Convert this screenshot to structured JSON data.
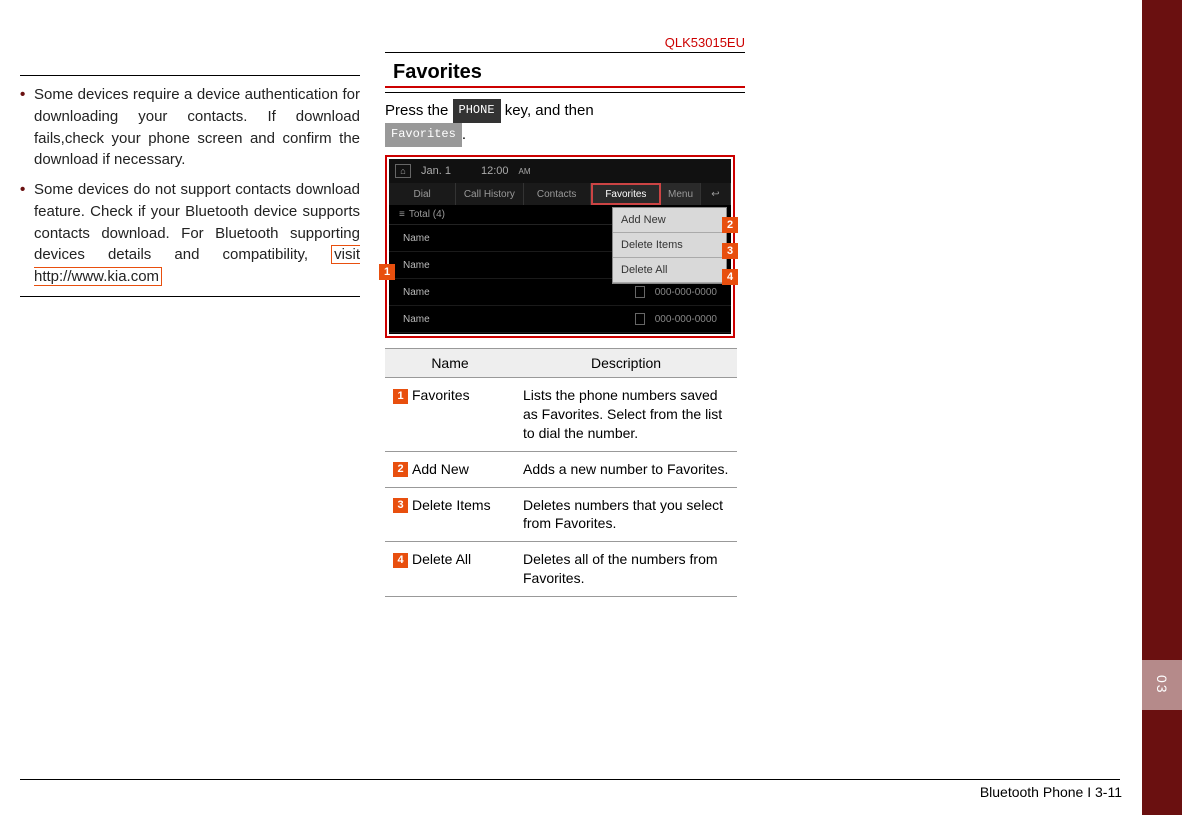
{
  "doc_code": "QLK53015EU",
  "footer": "Bluetooth Phone I 3-11",
  "side_tab": "03",
  "left": {
    "bullets": [
      "Some devices require a device authentication for downloading your contacts. If download fails,check your phone screen and confirm the download if necessary.",
      "Some devices do not support contacts download feature. Check if your Bluetooth device supports contacts download. For Bluetooth supporting devices details and compatibility, "
    ],
    "boxed_link": "visit http://www.kia.com"
  },
  "right": {
    "section_title": "Favorites",
    "instr_prefix": "Press the ",
    "key_phone": "PHONE",
    "instr_mid": " key, and then ",
    "key_fav": "Favorites",
    "instr_suffix": "."
  },
  "screenshot": {
    "date": "Jan. 1",
    "time": "12:00",
    "ampm": "AM",
    "tabs": [
      "Dial",
      "Call History",
      "Contacts",
      "Favorites",
      "Menu"
    ],
    "back_glyph": "↩",
    "total": "Total (4)",
    "menu_items": [
      "Add New",
      "Delete Items",
      "Delete All"
    ],
    "rows": [
      {
        "name": "Name",
        "phone": ""
      },
      {
        "name": "Name",
        "phone": ""
      },
      {
        "name": "Name",
        "phone": "000-000-0000"
      },
      {
        "name": "Name",
        "phone": "000-000-0000"
      }
    ]
  },
  "callouts": {
    "c1": "1",
    "c2": "2",
    "c3": "3",
    "c4": "4"
  },
  "table": {
    "head_name": "Name",
    "head_desc": "Description",
    "rows": [
      {
        "num": "1",
        "name": "Favorites",
        "desc": "Lists the phone numbers saved as Favorites. Select from the list to dial the number."
      },
      {
        "num": "2",
        "name": "Add New",
        "desc": "Adds a new number to Favorites."
      },
      {
        "num": "3",
        "name": "Delete Items",
        "desc": "Deletes numbers that you select from Favorites."
      },
      {
        "num": "4",
        "name": "Delete All",
        "desc": "Deletes all of the numbers from Favorites."
      }
    ]
  }
}
